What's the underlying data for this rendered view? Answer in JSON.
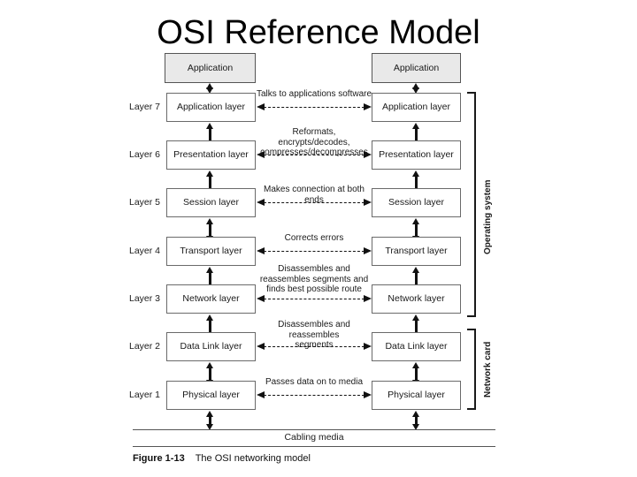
{
  "title": "OSI Reference Model",
  "top_boxes": {
    "left_label": "Application",
    "right_label": "Application"
  },
  "layers": [
    {
      "layer_label": "Layer 7",
      "left_box": "Application layer",
      "right_box": "Application layer",
      "link_caption": "Talks to applications software"
    },
    {
      "layer_label": "Layer 6",
      "left_box": "Presentation layer",
      "right_box": "Presentation layer",
      "link_caption": "Reformats, encrypts/decodes,\ncompresses/decompresses"
    },
    {
      "layer_label": "Layer 5",
      "left_box": "Session layer",
      "right_box": "Session layer",
      "link_caption": "Makes connection at both ends"
    },
    {
      "layer_label": "Layer 4",
      "left_box": "Transport layer",
      "right_box": "Transport layer",
      "link_caption": "Corrects errors"
    },
    {
      "layer_label": "Layer 3",
      "left_box": "Network layer",
      "right_box": "Network layer",
      "link_caption": "Disassembles and\nreassembles segments and\nfinds best possible route"
    },
    {
      "layer_label": "Layer 2",
      "left_box": "Data Link layer",
      "right_box": "Data Link layer",
      "link_caption": "Disassembles and reassembles\nsegments"
    },
    {
      "layer_label": "Layer 1",
      "left_box": "Physical layer",
      "right_box": "Physical layer",
      "link_caption": "Passes data on to media"
    }
  ],
  "brackets": [
    {
      "label": "Operating system"
    },
    {
      "label": "Network card"
    }
  ],
  "cabling": {
    "label": "Cabling media"
  },
  "caption": {
    "figure_number": "Figure 1-13",
    "figure_text": "The OSI networking model"
  },
  "colors": {
    "shaded_box_fill": "#e9e9e9",
    "box_border": "#6a6a6a",
    "line": "#111111",
    "background": "#ffffff"
  }
}
